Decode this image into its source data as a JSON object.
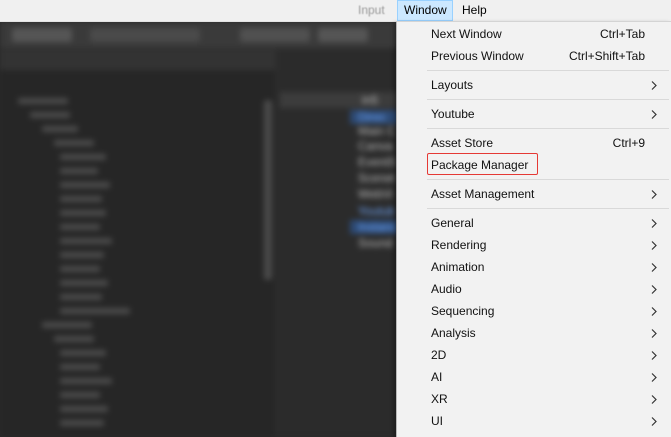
{
  "menubar": {
    "input_label": "Input",
    "window_label": "Window",
    "help_label": "Help"
  },
  "hierarchy": {
    "scene_name": "in5",
    "items": [
      "Direc",
      "Main C",
      "Canva",
      "EventS",
      "Scenet",
      "WebVi",
      "Youtub",
      "Instanc",
      "Sound"
    ]
  },
  "window_menu": {
    "next_window": {
      "label": "Next Window",
      "shortcut": "Ctrl+Tab"
    },
    "previous_window": {
      "label": "Previous Window",
      "shortcut": "Ctrl+Shift+Tab"
    },
    "layouts": {
      "label": "Layouts"
    },
    "youtube": {
      "label": "Youtube"
    },
    "asset_store": {
      "label": "Asset Store",
      "shortcut": "Ctrl+9"
    },
    "package_manager": {
      "label": "Package Manager"
    },
    "asset_management": {
      "label": "Asset Management"
    },
    "general": {
      "label": "General"
    },
    "rendering": {
      "label": "Rendering"
    },
    "animation": {
      "label": "Animation"
    },
    "audio": {
      "label": "Audio"
    },
    "sequencing": {
      "label": "Sequencing"
    },
    "analysis": {
      "label": "Analysis"
    },
    "two_d": {
      "label": "2D"
    },
    "ai": {
      "label": "AI"
    },
    "xr": {
      "label": "XR"
    },
    "ui": {
      "label": "UI"
    }
  },
  "colors": {
    "highlight_box": "#e53935",
    "menubar_active": "#cce8ff"
  }
}
